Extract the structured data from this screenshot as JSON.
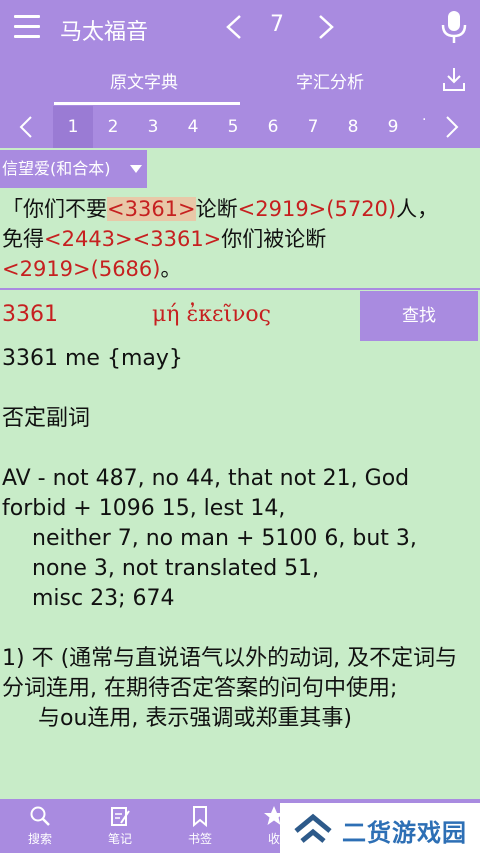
{
  "header": {
    "book_title": "马太福音",
    "chapter": "7",
    "tabs": [
      {
        "label": "原文字典"
      },
      {
        "label": "字汇分析"
      }
    ]
  },
  "verse_nav": {
    "numbers": [
      "1",
      "2",
      "3",
      "4",
      "5",
      "6",
      "7",
      "8",
      "9"
    ],
    "active": "1"
  },
  "version": {
    "selected": "信望爱(和合本)"
  },
  "verse": {
    "open_quote": "「",
    "seg1": "你们不要",
    "ref1": "<3361>",
    "seg2": "论断",
    "ref2": "<2919>",
    "ref3": "(5720)",
    "seg3": "人，",
    "seg4": "免得",
    "ref4": "<2443>",
    "ref5": "<3361>",
    "seg5": "你们被论断",
    "ref6": "<2919>",
    "ref7": "(5686)",
    "seg6": "。"
  },
  "entry": {
    "strong_number": "3361",
    "greek_word": "μή ἐκεῖνος",
    "find_label": "查找",
    "lines": {
      "l1": "3361 me {may}",
      "l2": "否定副词",
      "l3": "AV - not 487, no 44, that not 21, God forbid + 1096 15, lest 14,",
      "l4": "neither 7, no man + 5100 6, but 3, none 3, not translated 51,",
      "l5": "misc 23; 674",
      "l6": "1) 不 (通常与直说语气以外的动词, 及不定词与分词连用, 在期待否定答案的问句中使用;",
      "l7": "与ou连用, 表示强调或郑重其事)"
    }
  },
  "bottom_nav": [
    {
      "label": "搜索",
      "icon": "search-icon"
    },
    {
      "label": "笔记",
      "icon": "note-icon"
    },
    {
      "label": "书签",
      "icon": "bookmark-icon"
    },
    {
      "label": "收",
      "icon": "star-icon"
    }
  ],
  "watermark": {
    "text": "二货游戏园"
  },
  "colors": {
    "accent": "#a98be0",
    "background": "#c8ecc8",
    "reference": "#c62020"
  }
}
